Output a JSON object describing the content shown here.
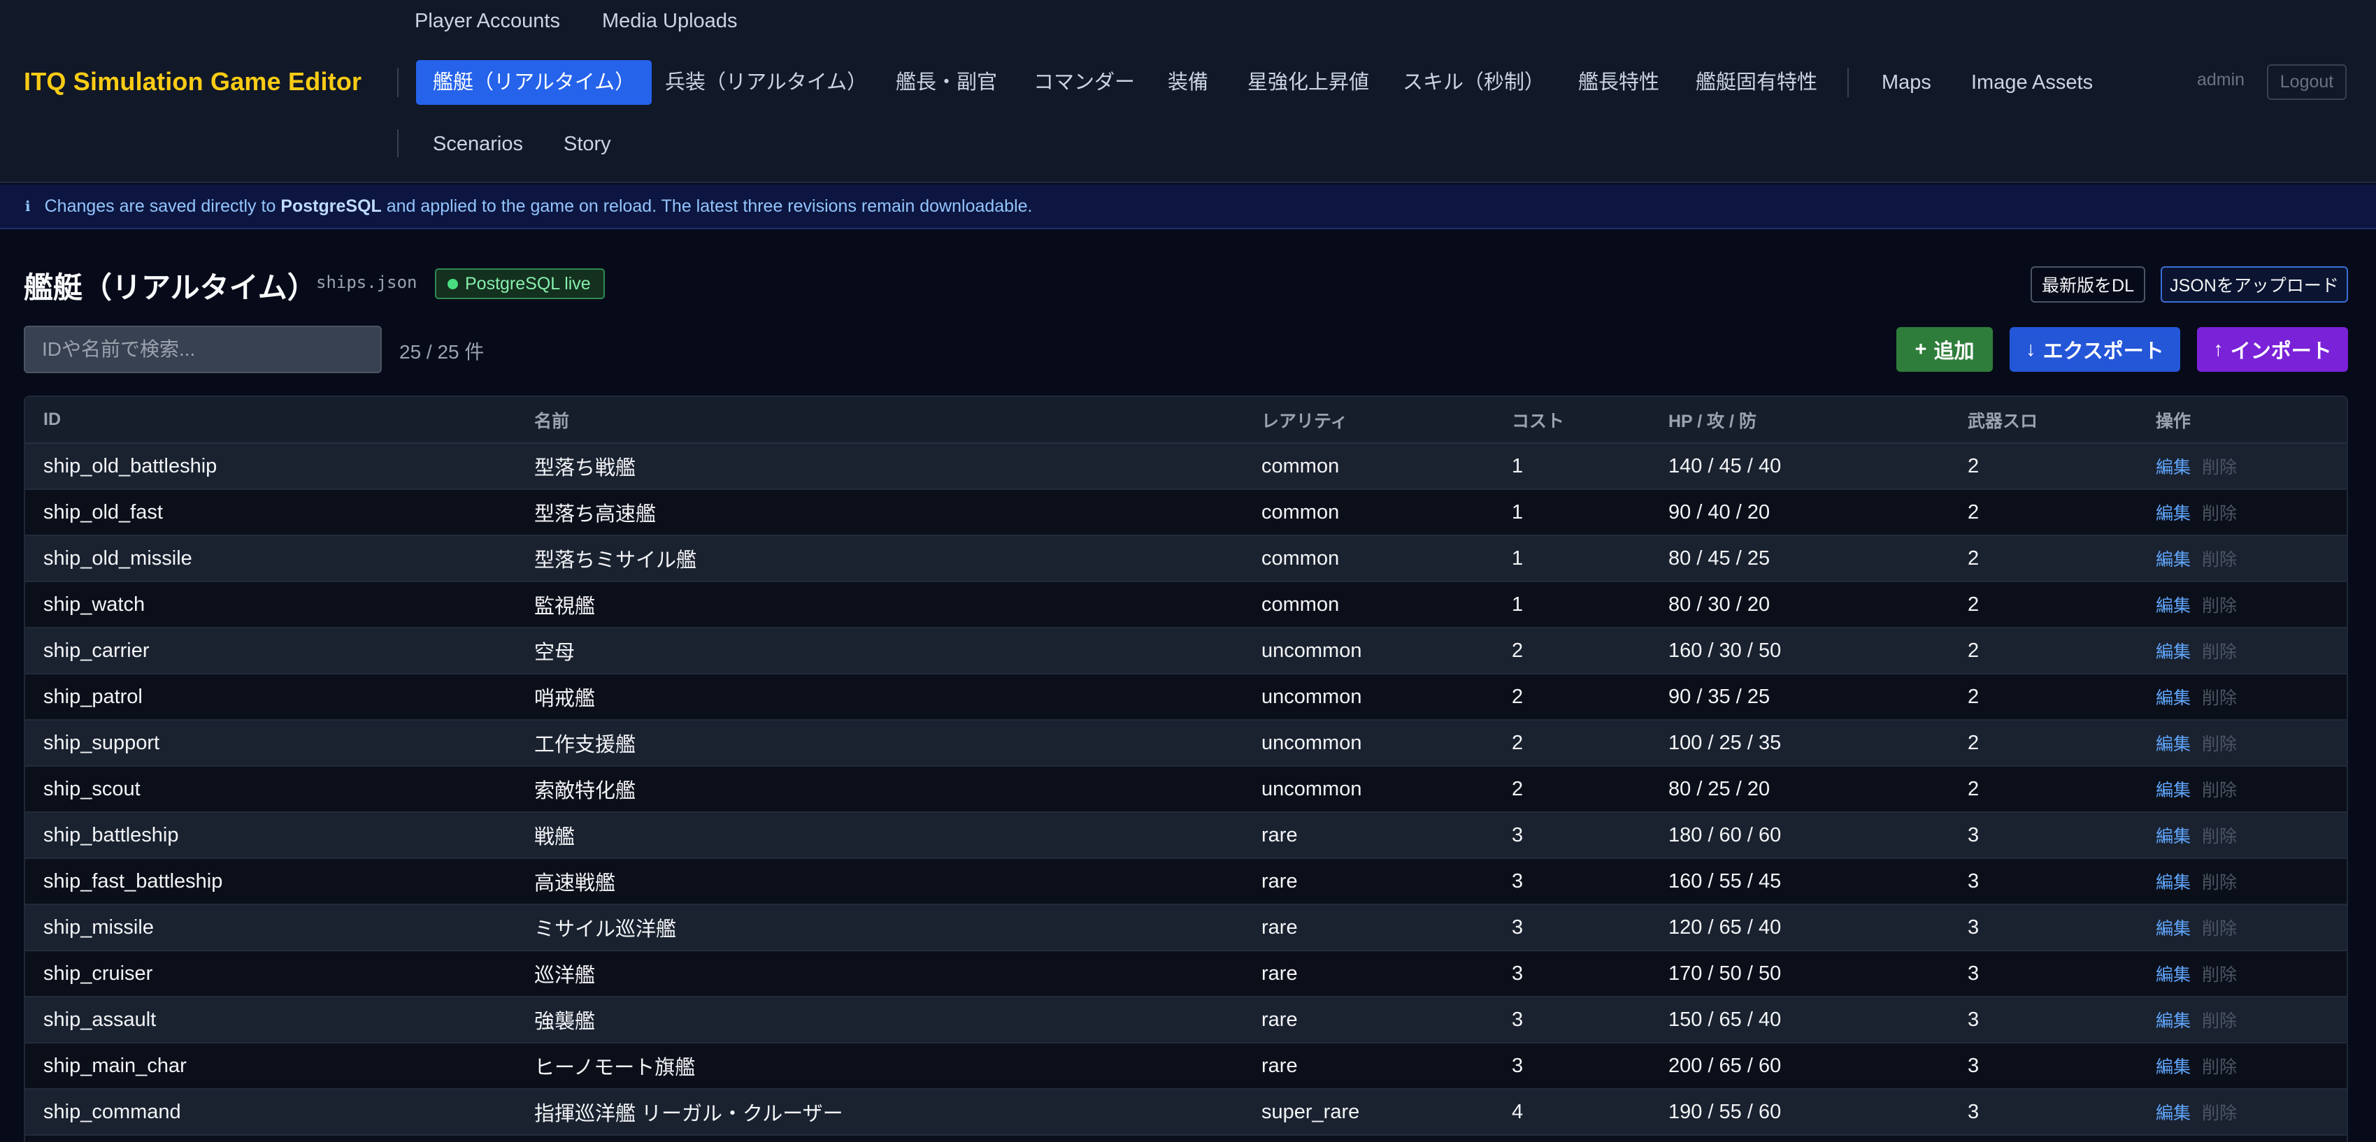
{
  "header": {
    "brand": "ITQ Simulation Game Editor",
    "top_links": [
      "Player Accounts",
      "Media Uploads"
    ],
    "tabs": [
      "艦艇（リアルタイム）",
      "兵装（リアルタイム）",
      "艦長・副官",
      "コマンダー",
      "装備",
      "星強化上昇値",
      "スキル（秒制）",
      "艦長特性",
      "艦艇固有特性"
    ],
    "extra_links": [
      "Maps",
      "Image Assets"
    ],
    "bottom_links": [
      "Scenarios",
      "Story"
    ],
    "user": "admin",
    "logout_label": "Logout"
  },
  "banner": {
    "icon": "ℹ",
    "text_before": "Changes are saved directly to",
    "db_name": "PostgreSQL",
    "text_after": "and applied to the game on reload. The latest three revisions remain downloadable."
  },
  "page": {
    "title": "艦艇（リアルタイム）",
    "file": "ships.json",
    "status": "PostgreSQL live",
    "download_latest": "最新版をDL",
    "upload_json": "JSONをアップロード"
  },
  "toolbar": {
    "search_placeholder": "IDや名前で検索...",
    "count": "25 / 25 件",
    "add_label": "追加",
    "export_label": "エクスポート",
    "import_label": "インポート"
  },
  "table": {
    "headers": [
      "ID",
      "名前",
      "レアリティ",
      "コスト",
      "HP / 攻 / 防",
      "武器スロ",
      "操作"
    ],
    "edit_label": "編集",
    "delete_label": "削除",
    "rows": [
      {
        "id": "ship_old_battleship",
        "name": "型落ち戦艦",
        "rarity": "common",
        "cost": "1",
        "stats": "140 / 45 / 40",
        "slots": "2"
      },
      {
        "id": "ship_old_fast",
        "name": "型落ち高速艦",
        "rarity": "common",
        "cost": "1",
        "stats": "90 / 40 / 20",
        "slots": "2"
      },
      {
        "id": "ship_old_missile",
        "name": "型落ちミサイル艦",
        "rarity": "common",
        "cost": "1",
        "stats": "80 / 45 / 25",
        "slots": "2"
      },
      {
        "id": "ship_watch",
        "name": "監視艦",
        "rarity": "common",
        "cost": "1",
        "stats": "80 / 30 / 20",
        "slots": "2"
      },
      {
        "id": "ship_carrier",
        "name": "空母",
        "rarity": "uncommon",
        "cost": "2",
        "stats": "160 / 30 / 50",
        "slots": "2"
      },
      {
        "id": "ship_patrol",
        "name": "哨戒艦",
        "rarity": "uncommon",
        "cost": "2",
        "stats": "90 / 35 / 25",
        "slots": "2"
      },
      {
        "id": "ship_support",
        "name": "工作支援艦",
        "rarity": "uncommon",
        "cost": "2",
        "stats": "100 / 25 / 35",
        "slots": "2"
      },
      {
        "id": "ship_scout",
        "name": "索敵特化艦",
        "rarity": "uncommon",
        "cost": "2",
        "stats": "80 / 25 / 20",
        "slots": "2"
      },
      {
        "id": "ship_battleship",
        "name": "戦艦",
        "rarity": "rare",
        "cost": "3",
        "stats": "180 / 60 / 60",
        "slots": "3"
      },
      {
        "id": "ship_fast_battleship",
        "name": "高速戦艦",
        "rarity": "rare",
        "cost": "3",
        "stats": "160 / 55 / 45",
        "slots": "3"
      },
      {
        "id": "ship_missile",
        "name": "ミサイル巡洋艦",
        "rarity": "rare",
        "cost": "3",
        "stats": "120 / 65 / 40",
        "slots": "3"
      },
      {
        "id": "ship_cruiser",
        "name": "巡洋艦",
        "rarity": "rare",
        "cost": "3",
        "stats": "170 / 50 / 50",
        "slots": "3"
      },
      {
        "id": "ship_assault",
        "name": "強襲艦",
        "rarity": "rare",
        "cost": "3",
        "stats": "150 / 65 / 40",
        "slots": "3"
      },
      {
        "id": "ship_main_char",
        "name": "ヒーノモート旗艦",
        "rarity": "rare",
        "cost": "3",
        "stats": "200 / 65 / 60",
        "slots": "3"
      },
      {
        "id": "ship_command",
        "name": "指揮巡洋艦 リーガル・クルーザー",
        "rarity": "super_rare",
        "cost": "4",
        "stats": "190 / 55 / 60",
        "slots": "3"
      }
    ]
  }
}
